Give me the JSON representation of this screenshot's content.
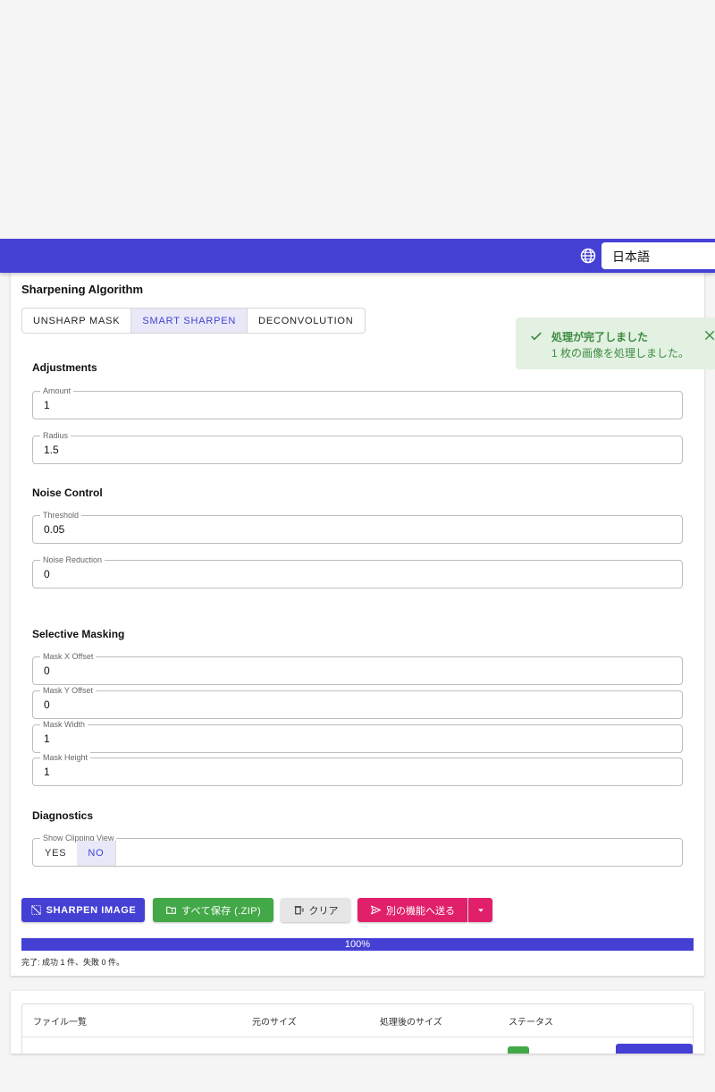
{
  "header": {
    "language": "日本語"
  },
  "algorithm": {
    "title": "Sharpening Algorithm",
    "options": [
      "UNSHARP MASK",
      "SMART SHARPEN",
      "DECONVOLUTION"
    ],
    "selected": "SMART SHARPEN"
  },
  "adjustments": {
    "title": "Adjustments",
    "amount": {
      "label": "Amount",
      "value": "1"
    },
    "radius": {
      "label": "Radius",
      "value": "1.5"
    }
  },
  "noise": {
    "title": "Noise Control",
    "threshold": {
      "label": "Threshold",
      "value": "0.05"
    },
    "reduction": {
      "label": "Noise Reduction",
      "value": "0"
    }
  },
  "masking": {
    "title": "Selective Masking",
    "x": {
      "label": "Mask X Offset",
      "value": "0"
    },
    "y": {
      "label": "Mask Y Offset",
      "value": "0"
    },
    "width": {
      "label": "Mask Width",
      "value": "1"
    },
    "height": {
      "label": "Mask Height",
      "value": "1"
    }
  },
  "diagnostics": {
    "title": "Diagnostics",
    "clipping": {
      "label": "Show Clipping View",
      "yes": "YES",
      "no": "NO",
      "selected": "NO"
    }
  },
  "actions": {
    "sharpen": "SHARPEN IMAGE",
    "save_zip": "すべて保存 (.ZIP)",
    "clear": "クリア",
    "send": "別の機能へ送る"
  },
  "progress": {
    "percent": 100,
    "label": "100%",
    "summary": "完了: 成功 1 件、失敗 0 件。"
  },
  "toast": {
    "title": "処理が完了しました",
    "message": "1 枚の画像を処理しました。",
    "color": "#3d8b40"
  },
  "files": {
    "headers": [
      "ファイル一覧",
      "元のサイズ",
      "処理後のサイズ",
      "ステータス"
    ]
  },
  "colors": {
    "primary": "#4540d4",
    "success": "#43a847",
    "accent": "#e0206a"
  }
}
